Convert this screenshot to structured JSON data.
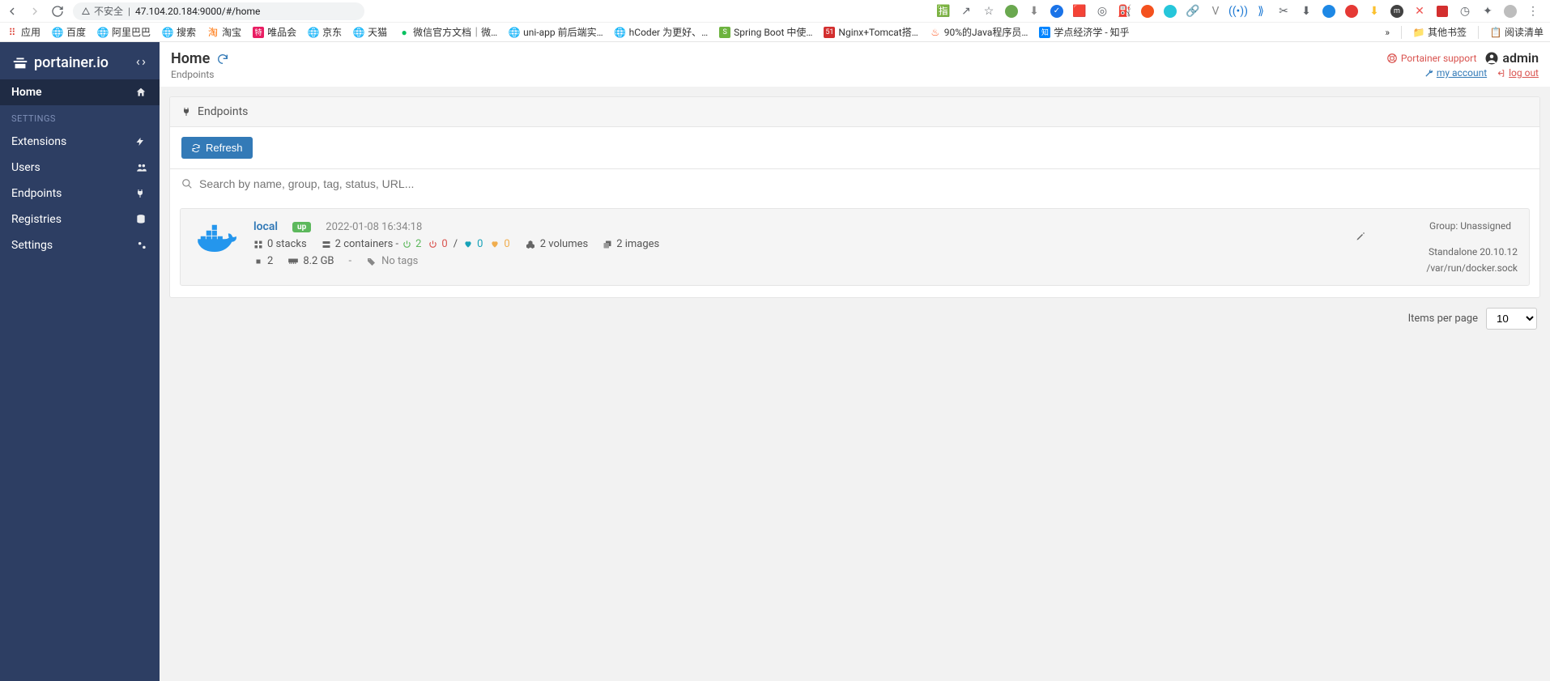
{
  "browser": {
    "insecure_label": "不安全",
    "url": "47.104.20.184:9000/#/home",
    "bookmarks": {
      "apps": "应用",
      "items": [
        "百度",
        "阿里巴巴",
        "搜索",
        "淘宝",
        "唯品会",
        "京东",
        "天猫",
        "微信官方文档｜微…",
        "uni-app 前后端实…",
        "hCoder 为更好、…",
        "Spring Boot 中使…",
        "Nginx+Tomcat搭…",
        "90%的Java程序员…",
        "学点经济学 - 知乎"
      ],
      "overflow": "»",
      "other": "其他书签",
      "reading": "阅读清单"
    }
  },
  "sidebar": {
    "brand": "portainer.io",
    "items": {
      "home": "Home",
      "settings_header": "SETTINGS",
      "extensions": "Extensions",
      "users": "Users",
      "endpoints": "Endpoints",
      "registries": "Registries",
      "settings": "Settings"
    }
  },
  "header": {
    "title": "Home",
    "subtitle": "Endpoints",
    "support": "Portainer support",
    "user": "admin",
    "my_account": "my account",
    "log_out": "log out"
  },
  "panel": {
    "title": "Endpoints",
    "refresh": "Refresh",
    "search_placeholder": "Search by name, group, tag, status, URL..."
  },
  "endpoint": {
    "name": "local",
    "status": "up",
    "timestamp": "2022-01-08 16:34:18",
    "stacks": "0 stacks",
    "containers_prefix": "2 containers - ",
    "power_on": "2",
    "power_off": "0",
    "healthy": "0",
    "unhealthy": "0",
    "volumes": "2 volumes",
    "images": "2 images",
    "cpu": "2",
    "ram": "8.2 GB",
    "dash": "-",
    "tags": "No tags",
    "group": "Group: Unassigned",
    "type": "Standalone 20.10.12",
    "socket": "/var/run/docker.sock"
  },
  "pagination": {
    "label": "Items per page",
    "value": "10"
  }
}
